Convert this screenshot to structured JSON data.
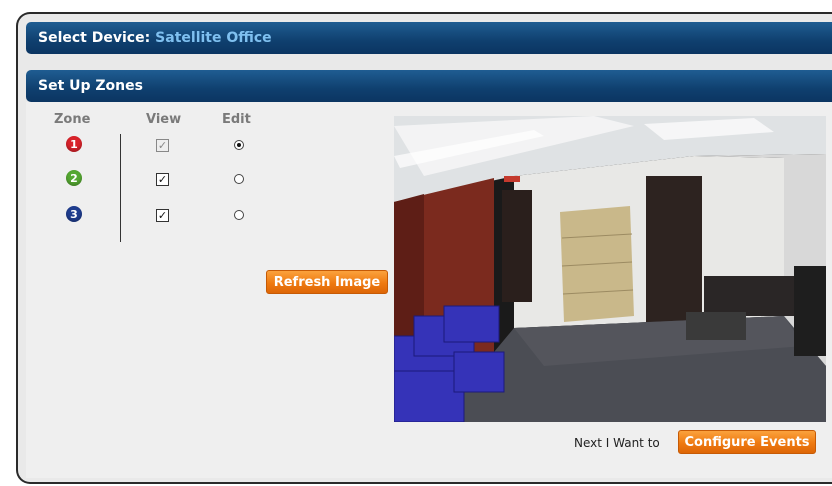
{
  "device_bar": {
    "label": "Select Device:",
    "device_name": "Satellite Office"
  },
  "zones_bar": {
    "title": "Set Up Zones"
  },
  "zones_table": {
    "headers": {
      "zone": "Zone",
      "view": "View",
      "edit": "Edit"
    },
    "rows": [
      {
        "number": "1",
        "color": "#d9232b",
        "view_checked": true,
        "view_disabled": true,
        "edit_selected": true
      },
      {
        "number": "2",
        "color": "#55a832",
        "view_checked": true,
        "view_disabled": false,
        "edit_selected": false
      },
      {
        "number": "3",
        "color": "#1f3d8f",
        "view_checked": true,
        "view_disabled": false,
        "edit_selected": false
      }
    ]
  },
  "refresh_button": {
    "label": "Refresh Image"
  },
  "footer": {
    "prompt": "Next I Want to",
    "configure_button": "Configure Events"
  },
  "colors": {
    "accent": "#ef7a11",
    "header_bar": "#0f3f6e",
    "device_name": "#7fc0f0"
  }
}
